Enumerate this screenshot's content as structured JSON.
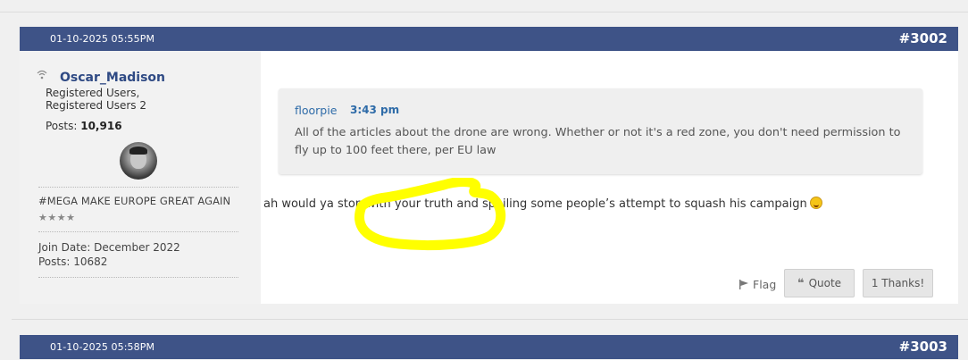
{
  "posts": [
    {
      "date": "01-10-2025 05:55PM",
      "number": "#3002",
      "user": {
        "status_icon": "wifi-icon",
        "username": "Oscar_Madison",
        "title": "Registered Users, Registered Users 2",
        "posts_label": "Posts:",
        "posts_value": "10,916",
        "signature_motto": "#MEGA MAKE EUROPE GREAT AGAIN",
        "stars": "★★★★",
        "join_date": "Join Date: December 2022",
        "posts_count": "Posts: 10682"
      },
      "quote": {
        "author": "floorpie",
        "time": "3:43 pm",
        "text": "All of the articles about the drone are wrong. Whether or not it's a red zone, you don't need permission to fly up to 100 feet there, per EU law"
      },
      "text": "ah would ya stop with your truth and spoiling some people’s attempt to squash his campaign",
      "emoji": "winking-tongue-emoji",
      "actions": {
        "flag_label": "Flag",
        "quote_label": "Quote",
        "thanks_label": "1 Thanks!"
      }
    },
    {
      "date": "01-10-2025 05:58PM",
      "number": "#3003"
    }
  ],
  "colors": {
    "header_bg": "#3e5387",
    "username": "#2f4a84",
    "quote_author": "#2e6ba8",
    "highlight": "#ffff00"
  }
}
